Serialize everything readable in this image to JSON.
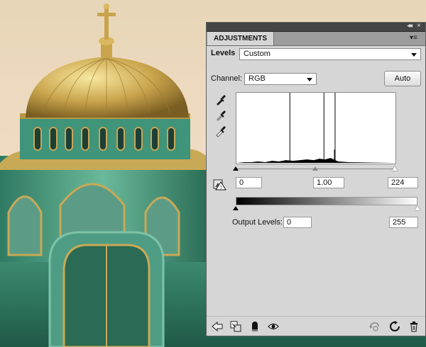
{
  "panel": {
    "tab_label": "ADJUSTMENTS",
    "adjustment_name": "Levels",
    "preset_value": "Custom",
    "channel_label": "Channel:",
    "channel_value": "RGB",
    "auto_button_label": "Auto",
    "input_levels": {
      "black": "0",
      "midtone": "1.00",
      "white": "224"
    },
    "output_levels_label": "Output Levels:",
    "output_levels": {
      "black": "0",
      "white": "255"
    }
  },
  "icons": {
    "collapse": "double-left-arrow-icon",
    "close": "close-icon",
    "panel_menu": "panel-menu-icon",
    "eyedroppers": [
      "black-point-eyedropper-icon",
      "gray-point-eyedropper-icon",
      "white-point-eyedropper-icon"
    ],
    "clip_warning": "clipping-warning-icon",
    "footer_left": [
      "back-arrow-icon",
      "clip-to-layer-icon",
      "mask-icon",
      "visibility-eye-icon"
    ],
    "footer_right": [
      "view-previous-state-icon",
      "reset-icon",
      "trash-icon"
    ]
  },
  "colors": {
    "panel_bg": "#d6d6d6",
    "titlebar_bg": "#454545",
    "tabbar_bg": "#9c9c9c"
  }
}
